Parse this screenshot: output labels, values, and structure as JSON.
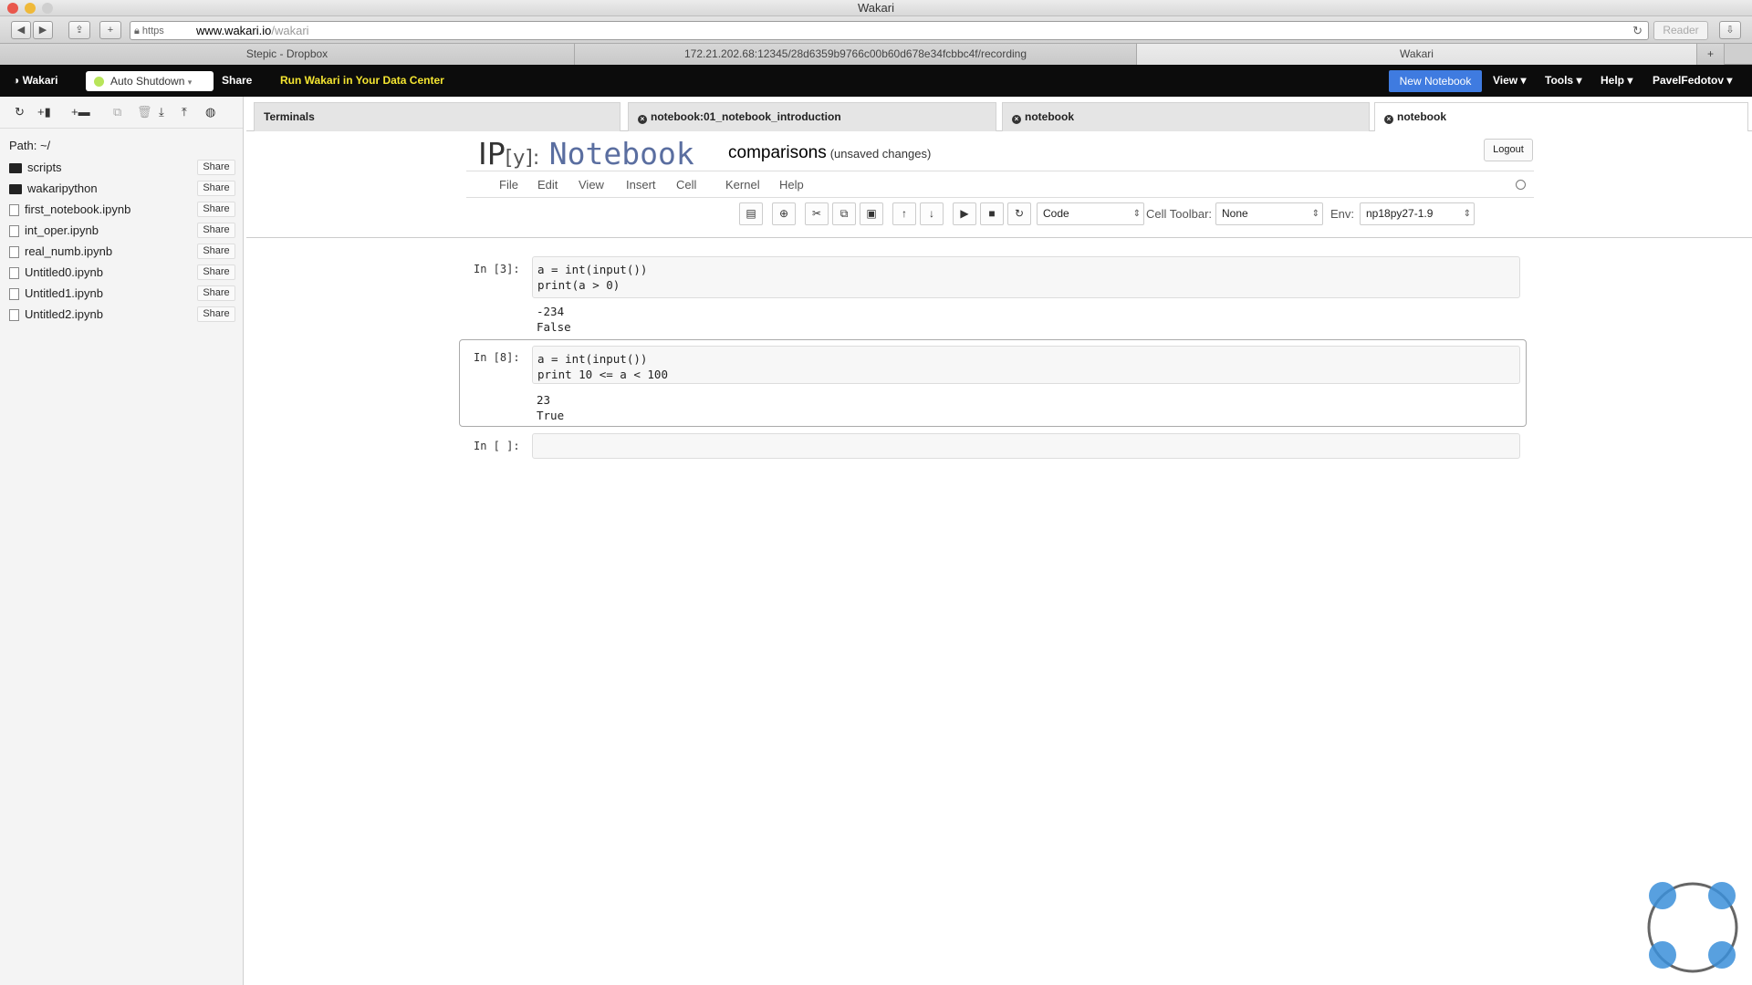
{
  "browser": {
    "window_title": "Wakari",
    "url_scheme": "https",
    "url_host": "www.wakari.io",
    "url_path": "/wakari",
    "reader_label": "Reader",
    "tabs": [
      {
        "label": "Stepic - Dropbox"
      },
      {
        "label": "172.21.202.68:12345/28d6359b9766c00b60d678e34fcbbc4f/recording"
      },
      {
        "label": "Wakari"
      }
    ]
  },
  "wakari_bar": {
    "brand": "Wakari",
    "auto_shutdown_label": "Auto Shutdown",
    "share_label": "Share",
    "promo": "Run Wakari in Your Data Center",
    "new_notebook_label": "New Notebook",
    "menus": [
      "View",
      "Tools",
      "Help",
      "PavelFedotov"
    ]
  },
  "sidebar": {
    "path": "Path: ~/",
    "share_label": "Share",
    "items": [
      {
        "name": "scripts",
        "type": "folder"
      },
      {
        "name": "wakaripython",
        "type": "folder"
      },
      {
        "name": "first_notebook.ipynb",
        "type": "file"
      },
      {
        "name": "int_oper.ipynb",
        "type": "file"
      },
      {
        "name": "real_numb.ipynb",
        "type": "file"
      },
      {
        "name": "Untitled0.ipynb",
        "type": "file"
      },
      {
        "name": "Untitled1.ipynb",
        "type": "file"
      },
      {
        "name": "Untitled2.ipynb",
        "type": "file"
      }
    ]
  },
  "main_tabs": [
    {
      "label": "Terminals"
    },
    {
      "label": "notebook:01_notebook_introduction"
    },
    {
      "label": "notebook"
    },
    {
      "label": "notebook"
    }
  ],
  "notebook": {
    "logo_ip": "IP",
    "logo_y": "[y]:",
    "logo_nb": "Notebook",
    "name": "comparisons",
    "status": "(unsaved changes)",
    "logout_label": "Logout",
    "menu": [
      "File",
      "Edit",
      "View",
      "Insert",
      "Cell",
      "Kernel",
      "Help"
    ],
    "cell_type": "Code",
    "cell_toolbar_label": "Cell Toolbar:",
    "cell_toolbar_value": "None",
    "env_label": "Env:",
    "env_value": "np18py27-1.9"
  },
  "cells": [
    {
      "prompt": "In [3]:",
      "line1": "a = int(input())",
      "line2": "print(a > 0)",
      "out1": "-234",
      "out2": "False"
    },
    {
      "prompt": "In [8]:",
      "line1": "a = int(input())",
      "line2": "print 10 <= a < 100",
      "out1": "23",
      "out2": "True"
    },
    {
      "prompt": "In [ ]:"
    }
  ],
  "colors": {
    "accent": "#3f7be0",
    "promo": "#f4e531",
    "spinner": "#3b8fd9"
  }
}
